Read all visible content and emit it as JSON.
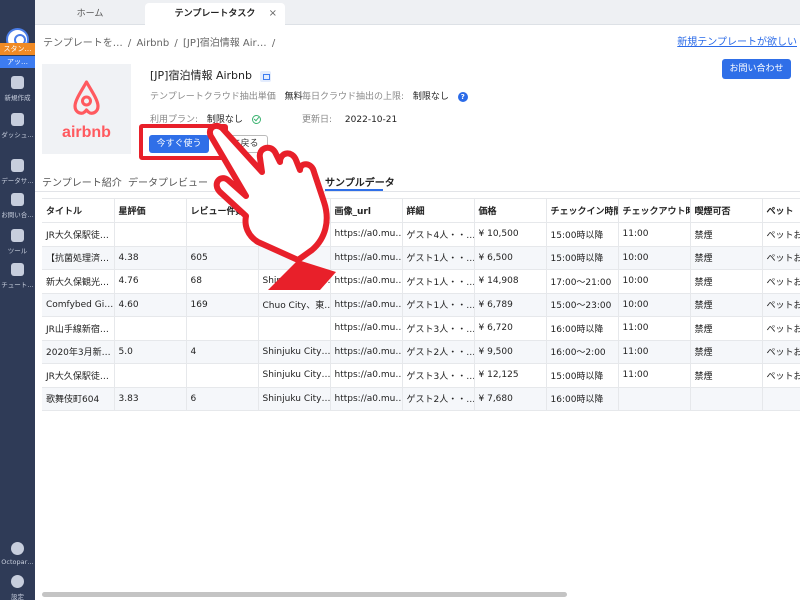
{
  "sidebar": {
    "badge_top": "スタン…",
    "badge_bottom": "アッ…",
    "items": [
      {
        "label": "新規作成",
        "icon": "plus-icon"
      },
      {
        "label": "ダッシュ…",
        "icon": "bookmark-icon"
      },
      {
        "label": "データサ…",
        "icon": "heart-icon"
      },
      {
        "label": "お問い合…",
        "icon": "headset-icon"
      },
      {
        "label": "ツール",
        "icon": "toolbox-icon"
      },
      {
        "label": "チュート…",
        "icon": "graduation-cap-icon"
      },
      {
        "label": "Octopar…",
        "icon": "info-icon"
      },
      {
        "label": "設定",
        "icon": "gear-icon"
      }
    ]
  },
  "tabs": {
    "home": "ホーム",
    "active": "テンプレートタスク",
    "close": "×"
  },
  "breadcrumb": [
    "テンプレートを…",
    "/",
    "Airbnb",
    "/",
    "[JP]宿泊情報 Air…",
    "/"
  ],
  "top_link": "新規テンプレートが欲しい",
  "template": {
    "logo_text": "airbnb",
    "title": "[JP]宿泊情報 Airbnb",
    "price_label": "テンプレートクラウド抽出単価",
    "price_value": "無料",
    "daily_label": "毎日クラウド抽出の上限:",
    "daily_value": "制限なし",
    "plan_label": "利用プラン:",
    "plan_value": "制限なし",
    "updated_label": "更新日:",
    "updated_value": "2022-10-21",
    "use_button": "今すぐ使う",
    "back_button": "に戻る",
    "contact_button": "お問い合わせ"
  },
  "section_tabs": [
    "テンプレート紹介",
    "データプレビュー",
    "パ",
    "サンプルデータ"
  ],
  "table": {
    "columns": [
      "タイトル",
      "星評価",
      "レビュー件数",
      "",
      "画像_url",
      "詳細",
      "価格",
      "チェックイン時間",
      "チェックアウト時",
      "喫煙可否",
      "ペット"
    ],
    "rows": [
      [
        "JR大久保駅徒…",
        "",
        "",
        "",
        "https://a0.mu…",
        "ゲスト4人・・…",
        "¥ 10,500",
        "15:00時以降",
        "11:00",
        "禁煙",
        "ペットお"
      ],
      [
        "【抗菌処理済…",
        "4.38",
        "605",
        "",
        "https://a0.mu…",
        "ゲスト1人・・…",
        "¥ 6,500",
        "15:00時以降",
        "10:00",
        "禁煙",
        "ペットお"
      ],
      [
        "新大久保観光…",
        "4.76",
        "68",
        "Shinjuku City…",
        "https://a0.mu…",
        "ゲスト1人・・…",
        "¥ 14,908",
        "17:00～21:00",
        "10:00",
        "禁煙",
        "ペットお"
      ],
      [
        "Comfybed Gi…",
        "4.60",
        "169",
        "Chuo City、東…",
        "https://a0.mu…",
        "ゲスト1人・・…",
        "¥ 6,789",
        "15:00～23:00",
        "10:00",
        "禁煙",
        "ペットお"
      ],
      [
        "JR山手線新宿…",
        "",
        "",
        "",
        "https://a0.mu…",
        "ゲスト3人・・…",
        "¥ 6,720",
        "16:00時以降",
        "11:00",
        "禁煙",
        "ペットお"
      ],
      [
        "2020年3月新…",
        "5.0",
        "4",
        "Shinjuku City…",
        "https://a0.mu…",
        "ゲスト2人・・…",
        "¥ 9,500",
        "16:00～2:00",
        "11:00",
        "禁煙",
        "ペットお"
      ],
      [
        "JR大久保駅徒…",
        "",
        "",
        "Shinjuku City…",
        "https://a0.mu…",
        "ゲスト3人・・…",
        "¥ 12,125",
        "15:00時以降",
        "11:00",
        "禁煙",
        "ペットお"
      ],
      [
        "歌舞伎町604",
        "3.83",
        "6",
        "Shinjuku City…",
        "https://a0.mu…",
        "ゲスト2人・・…",
        "¥ 7,680",
        "16:00時以降",
        "",
        "",
        ""
      ]
    ]
  },
  "colors": {
    "accent": "#2f6fe8",
    "sidebar": "#2f3b57",
    "highlight": "#e8202a",
    "brand": "#ff5a5f"
  }
}
